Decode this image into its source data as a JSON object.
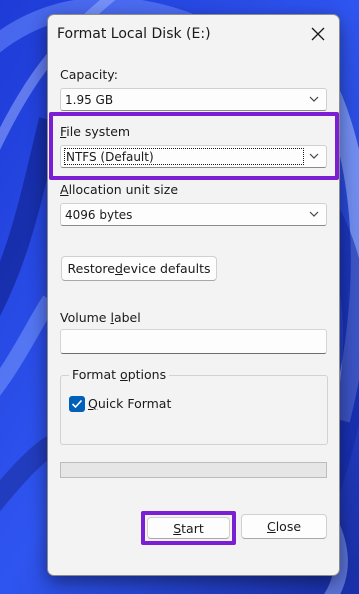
{
  "dialog": {
    "title": "Format Local Disk (E:)"
  },
  "capacity": {
    "label": "Capacity:",
    "value": "1.95 GB"
  },
  "file_system": {
    "label_mnemonic": "F",
    "label_rest": "ile system",
    "value": "NTFS (Default)"
  },
  "allocation": {
    "label_mnemonic": "A",
    "label_rest": "llocation unit size",
    "value": "4096 bytes"
  },
  "restore": {
    "label_pre": "Restore ",
    "label_mnemonic": "d",
    "label_post": "evice defaults"
  },
  "volume": {
    "label_pre": "Volume ",
    "label_mnemonic": "l",
    "label_post": "abel",
    "value": ""
  },
  "format_options": {
    "title_pre": "Format ",
    "title_mnemonic": "o",
    "title_post": "ptions",
    "quick_format_mnemonic": "Q",
    "quick_format_rest": "uick Format",
    "quick_format_checked": true
  },
  "progress": {
    "fraction": 0
  },
  "buttons": {
    "start_mnemonic": "S",
    "start_rest": "tart",
    "close_mnemonic": "C",
    "close_rest": "lose"
  },
  "colors": {
    "highlight": "#7b1fd4",
    "checkbox_accent": "#005fb8",
    "wallpaper_base": "#2a3fd0"
  },
  "icons": [
    "close-icon",
    "chevron-down-icon",
    "checkmark-icon"
  ]
}
